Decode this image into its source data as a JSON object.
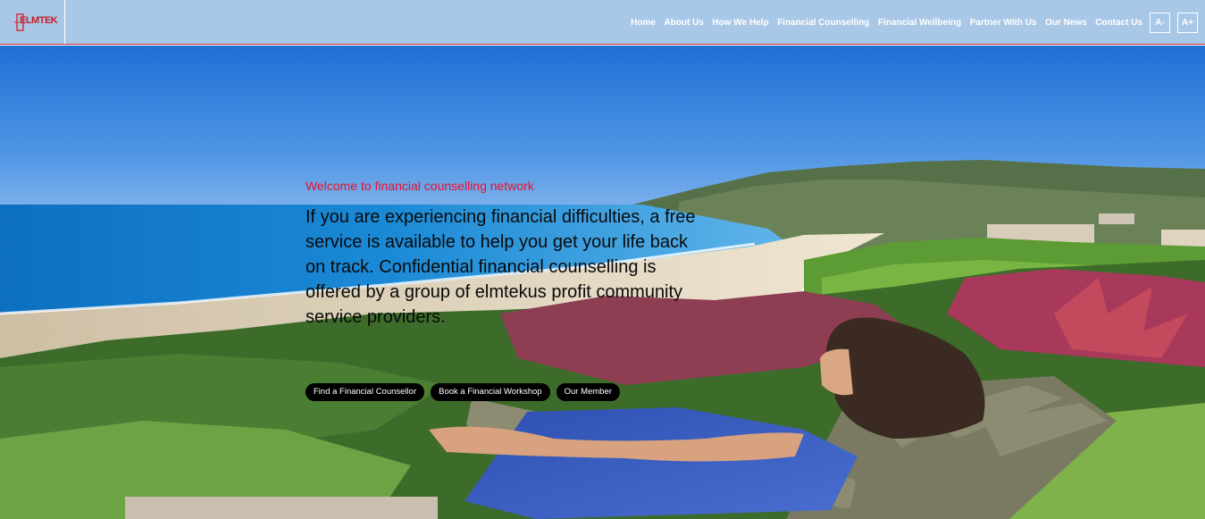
{
  "header": {
    "logo_text": "ELMTEK",
    "nav": [
      {
        "label": "Home"
      },
      {
        "label": "About Us"
      },
      {
        "label": "How We Help"
      },
      {
        "label": "Financial Counselling"
      },
      {
        "label": "Financial Wellbeing"
      },
      {
        "label": "Partner With Us"
      },
      {
        "label": "Our News"
      },
      {
        "label": "Contact Us"
      }
    ],
    "font_decrease_label": "A-",
    "font_increase_label": "A+"
  },
  "hero": {
    "welcome": "Welcome to financial counselling network",
    "heading": "If you are experiencing financial difficulties, a free service is available to help you get your life back on track. Confidential financial counselling is offered by a group of elmtekus profit community service providers.",
    "buttons": [
      {
        "label": "Find a Financial Counsellor"
      },
      {
        "label": "Book a Financial Workshop"
      },
      {
        "label": "Our Member"
      }
    ]
  },
  "colors": {
    "header_bg": "#a9c8e8",
    "header_border": "#d9313a",
    "accent_red": "#e8112d",
    "button_bg": "#000000"
  }
}
